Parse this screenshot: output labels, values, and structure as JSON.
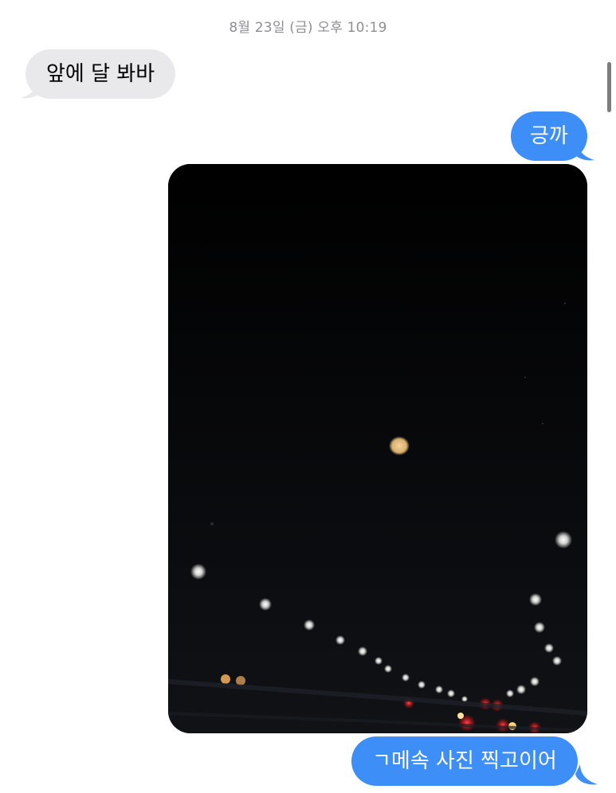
{
  "thread": {
    "timestamp": "8월 23일 (금) 오후 10:19",
    "messages": [
      {
        "direction": "incoming",
        "type": "text",
        "text": "앞에 달 봐바"
      },
      {
        "direction": "outgoing",
        "type": "text",
        "text": "긍까"
      },
      {
        "direction": "outgoing",
        "type": "photo",
        "subject": "moon-over-night-highway"
      },
      {
        "direction": "outgoing",
        "type": "text",
        "text": "ㄱ메속 사진 찍고이어"
      }
    ]
  },
  "colors": {
    "incoming_bubble": "#e9e9eb",
    "outgoing_bubble": "#3e8ef7",
    "timestamp": "#8e8e93",
    "background": "#ffffff"
  }
}
